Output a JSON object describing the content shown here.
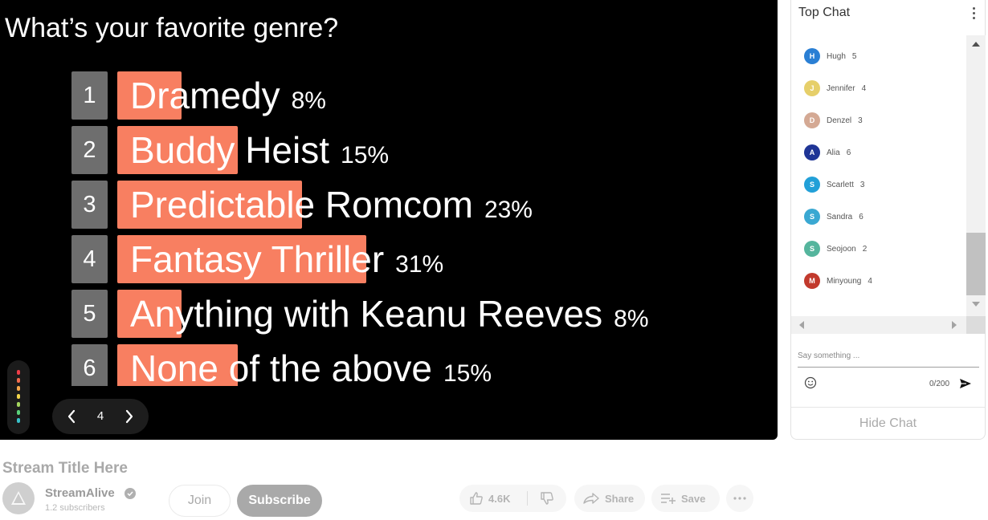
{
  "poll": {
    "question": "What’s your favorite genre?",
    "options": [
      {
        "num": "1",
        "label": "Dramedy",
        "pct": "8%",
        "value": 0.08
      },
      {
        "num": "2",
        "label": "Buddy Heist",
        "pct": "15%",
        "value": 0.15
      },
      {
        "num": "3",
        "label": "Predictable Romcom",
        "pct": "23%",
        "value": 0.23
      },
      {
        "num": "4",
        "label": "Fantasy Thriller",
        "pct": "31%",
        "value": 0.31
      },
      {
        "num": "5",
        "label": "Anything with Keanu Reeves",
        "pct": "8%",
        "value": 0.08
      },
      {
        "num": "6",
        "label": "None of the above",
        "pct": "15%",
        "value": 0.15
      }
    ],
    "bar_color": "#f87f61",
    "pager": {
      "current": "4"
    }
  },
  "level_meter_colors": [
    "#ee3d48",
    "#f26b4d",
    "#f6a84d",
    "#f3d64b",
    "#a4d65e",
    "#5ad27a",
    "#39c1c9"
  ],
  "chat": {
    "title": "Top Chat",
    "users": [
      {
        "initial": "H",
        "name": "Hugh",
        "count": "5",
        "color": "#2a7fd4"
      },
      {
        "initial": "J",
        "name": "Jennifer",
        "count": "4",
        "color": "#e6cf6a"
      },
      {
        "initial": "D",
        "name": "Denzel",
        "count": "3",
        "color": "#d4a994"
      },
      {
        "initial": "A",
        "name": "Alia",
        "count": "6",
        "color": "#1f3596"
      },
      {
        "initial": "S",
        "name": "Scarlett",
        "count": "3",
        "color": "#22a0d8"
      },
      {
        "initial": "S",
        "name": "Sandra",
        "count": "6",
        "color": "#3aa8d2"
      },
      {
        "initial": "S",
        "name": "Seojoon",
        "count": "2",
        "color": "#55b59d"
      },
      {
        "initial": "M",
        "name": "Minyoung",
        "count": "4",
        "color": "#c23a2d"
      }
    ],
    "input_placeholder": "Say something ...",
    "char_count": "0/200",
    "hide_label": "Hide Chat"
  },
  "stream": {
    "title": "Stream Title Here",
    "channel_name": "StreamAlive",
    "subscribers": "1.2 subscribers",
    "join_label": "Join",
    "subscribe_label": "Subscribe",
    "like_count": "4.6K",
    "share_label": "Share",
    "save_label": "Save"
  }
}
